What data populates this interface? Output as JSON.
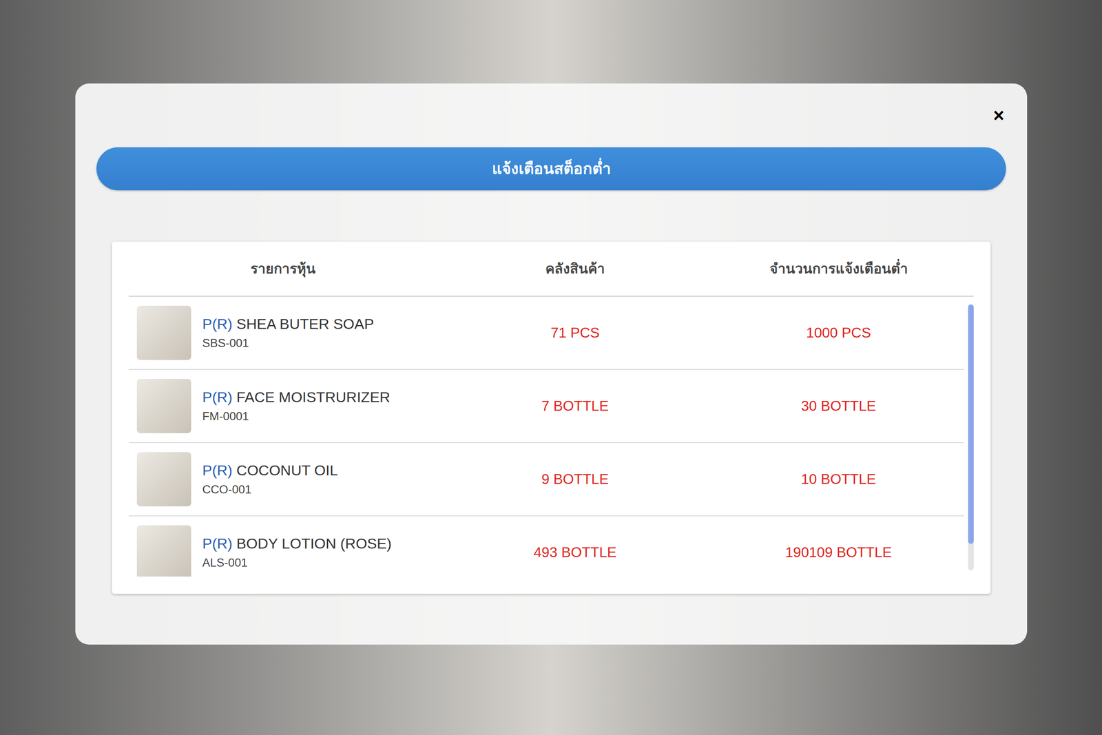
{
  "dialog": {
    "title": "แจ้งเตือนสต็อกต่ำ",
    "close": "×"
  },
  "table": {
    "columns": [
      "รายการหุ้น",
      "คลังสินค้า",
      "จำนวนการแจ้งเตือนต่ำ"
    ],
    "rows": [
      {
        "prefix": "P(R)",
        "name": "SHEA BUTER SOAP",
        "code": "SBS-001",
        "stock": "71 PCS",
        "alert": "1000 PCS"
      },
      {
        "prefix": "P(R)",
        "name": "FACE MOISTRURIZER",
        "code": "FM-0001",
        "stock": "7 BOTTLE",
        "alert": "30 BOTTLE"
      },
      {
        "prefix": "P(R)",
        "name": "COCONUT OIL",
        "code": "CCO-001",
        "stock": "9 BOTTLE",
        "alert": "10 BOTTLE"
      },
      {
        "prefix": "P(R)",
        "name": "BODY LOTION (ROSE)",
        "code": "ALS-001",
        "stock": "493 BOTTLE",
        "alert": "190109 BOTTLE"
      }
    ]
  },
  "scrollbar": {
    "level": 0.9
  }
}
